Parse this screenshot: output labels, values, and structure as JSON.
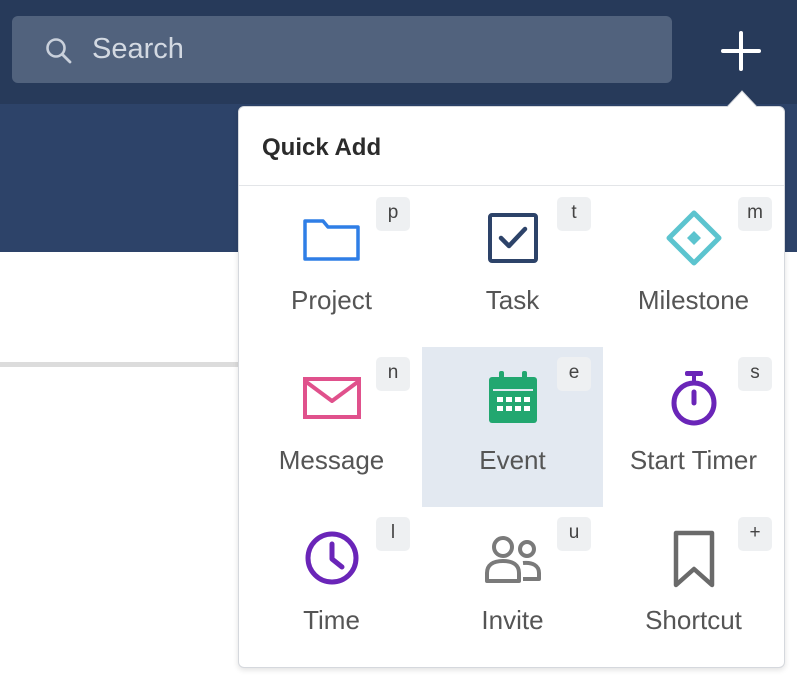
{
  "search": {
    "placeholder": "Search",
    "value": ""
  },
  "quick_add": {
    "title": "Quick Add",
    "items": [
      {
        "label": "Project",
        "shortcut": "p",
        "icon": "folder-icon",
        "color": "#2f7ee6"
      },
      {
        "label": "Task",
        "shortcut": "t",
        "icon": "checkbox-icon",
        "color": "#2d4369"
      },
      {
        "label": "Milestone",
        "shortcut": "m",
        "icon": "milestone-icon",
        "color": "#5cc4cf"
      },
      {
        "label": "Message",
        "shortcut": "n",
        "icon": "envelope-icon",
        "color": "#e0518c"
      },
      {
        "label": "Event",
        "shortcut": "e",
        "icon": "calendar-icon",
        "color": "#22a770",
        "selected": true
      },
      {
        "label": "Start Timer",
        "shortcut": "s",
        "icon": "stopwatch-icon",
        "color": "#6a25b8"
      },
      {
        "label": "Time",
        "shortcut": "l",
        "icon": "clock-icon",
        "color": "#6a25b8"
      },
      {
        "label": "Invite",
        "shortcut": "u",
        "icon": "people-icon",
        "color": "#7a7a7a"
      },
      {
        "label": "Shortcut",
        "shortcut": "+",
        "icon": "bookmark-icon",
        "color": "#6a6a6a"
      }
    ]
  },
  "colors": {
    "topbar": "#273a5a",
    "subbar": "#2d4369",
    "selected_tile": "#e3e9f1"
  }
}
